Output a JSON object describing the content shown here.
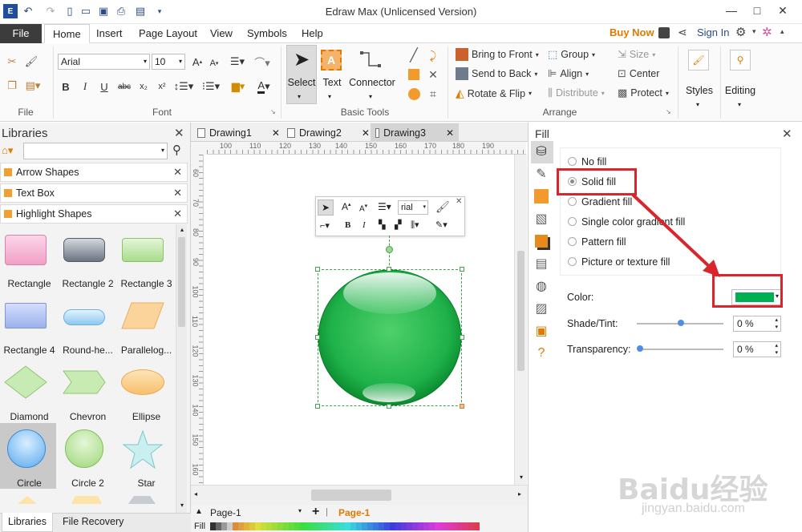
{
  "window": {
    "title": "Edraw Max (Unlicensed Version)",
    "minimize": "—",
    "maximize": "□",
    "close": "✕"
  },
  "menu": {
    "file": "File",
    "tabs": [
      "Home",
      "Insert",
      "Page Layout",
      "View",
      "Symbols",
      "Help"
    ],
    "buy_now": "Buy Now",
    "sign_in": "Sign In"
  },
  "ribbon": {
    "font_name": "Arial",
    "font_size": "10",
    "groups": {
      "file": "File",
      "font": "Font",
      "basic_tools": "Basic Tools",
      "arrange": "Arrange"
    },
    "select": "Select",
    "text": "Text",
    "connector": "Connector",
    "bring_to_front": "Bring to Front",
    "send_to_back": "Send to Back",
    "rotate_flip": "Rotate & Flip",
    "group": "Group",
    "align": "Align",
    "distribute": "Distribute",
    "size": "Size",
    "center": "Center",
    "protect": "Protect",
    "styles": "Styles",
    "editing": "Editing"
  },
  "libraries": {
    "title": "Libraries",
    "search_placeholder": "",
    "categories": [
      "Arrow Shapes",
      "Text Box",
      "Highlight Shapes"
    ],
    "shapes": [
      {
        "label": "Rectangle",
        "icon": "pink-rect"
      },
      {
        "label": "Rectangle 2",
        "icon": "gray-rect"
      },
      {
        "label": "Rectangle 3",
        "icon": "green-rect"
      },
      {
        "label": "Rectangle 4",
        "icon": "blue-rect"
      },
      {
        "label": "Round-he...",
        "icon": "blue-pill"
      },
      {
        "label": "Parallelog...",
        "icon": "orange-parallelogram"
      },
      {
        "label": "Diamond",
        "icon": "green-diamond"
      },
      {
        "label": "Chevron",
        "icon": "green-chevron"
      },
      {
        "label": "Ellipse",
        "icon": "orange-ellipse"
      },
      {
        "label": "Circle",
        "icon": "blue-circle"
      },
      {
        "label": "Circle 2",
        "icon": "green-circle"
      },
      {
        "label": "Star",
        "icon": "teal-star"
      }
    ],
    "bottom_tabs": [
      "Libraries",
      "File Recovery"
    ]
  },
  "documents": {
    "tabs": [
      "Drawing1",
      "Drawing2",
      "Drawing3"
    ],
    "ruler_h": [
      "100",
      "110",
      "120",
      "130",
      "140",
      "150",
      "160",
      "170",
      "180",
      "190"
    ],
    "ruler_v": [
      "60",
      "70",
      "80",
      "90",
      "100",
      "110",
      "120",
      "130",
      "140",
      "150",
      "160"
    ]
  },
  "mini_toolbar": {
    "font": "rial"
  },
  "fill": {
    "title": "Fill",
    "options": [
      "No fill",
      "Solid fill",
      "Gradient fill",
      "Single color gradient fill",
      "Pattern fill",
      "Picture or texture fill"
    ],
    "selected": "Solid fill",
    "color_label": "Color:",
    "color_value": "#00b050",
    "shade_label": "Shade/Tint:",
    "shade_value": "0 %",
    "transparency_label": "Transparency:",
    "transparency_value": "0 %"
  },
  "pages": {
    "page_select": "Page-1",
    "active_page": "Page-1",
    "fill_label": "Fill"
  },
  "watermark": {
    "text": "Baidu经验",
    "url": "jingyan.baidu.com"
  },
  "colors": {
    "accent": "#e07b00",
    "highlight_box": "#d9262d",
    "shape_green": "#1fb24a"
  }
}
